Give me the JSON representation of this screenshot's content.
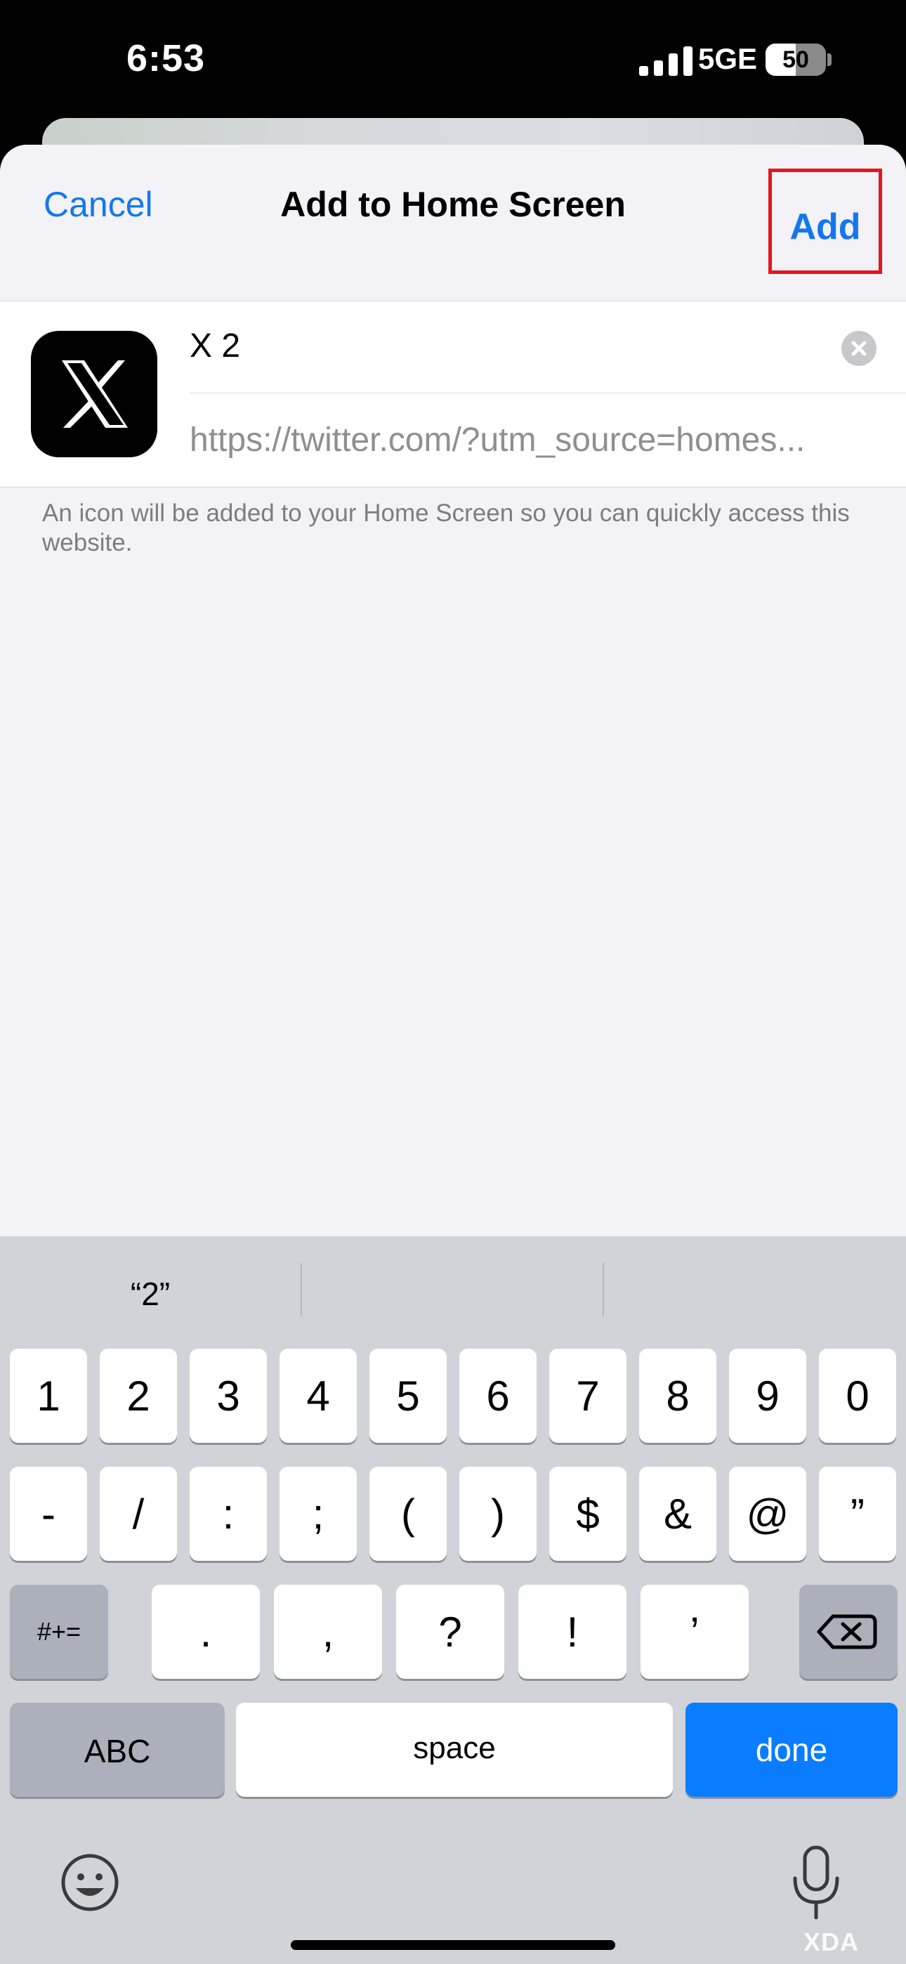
{
  "status": {
    "time": "6:53",
    "network": "5GE",
    "battery": "50",
    "battery_level": 0.5
  },
  "nav": {
    "cancel": "Cancel",
    "title": "Add to Home Screen",
    "add": "Add"
  },
  "form": {
    "name_value": "X 2",
    "url_value": "https://twitter.com/?utm_source=homes...",
    "footer": "An icon will be added to your Home Screen so you can quickly access this website."
  },
  "keyboard": {
    "suggestions": [
      "“2”",
      "",
      ""
    ],
    "row1": [
      "1",
      "2",
      "3",
      "4",
      "5",
      "6",
      "7",
      "8",
      "9",
      "0"
    ],
    "row2": [
      "-",
      "/",
      ":",
      ";",
      "(",
      ")",
      "$",
      "&",
      "@",
      "”"
    ],
    "row3_mode": "#+=",
    "row3": [
      ".",
      ",",
      "?",
      "!",
      "’"
    ],
    "abc": "ABC",
    "space": "space",
    "done": "done"
  },
  "watermark": "XDA",
  "colors": {
    "accent": "#1477f0",
    "highlight_box": "#e8141b",
    "done_key": "#0a7cff"
  }
}
